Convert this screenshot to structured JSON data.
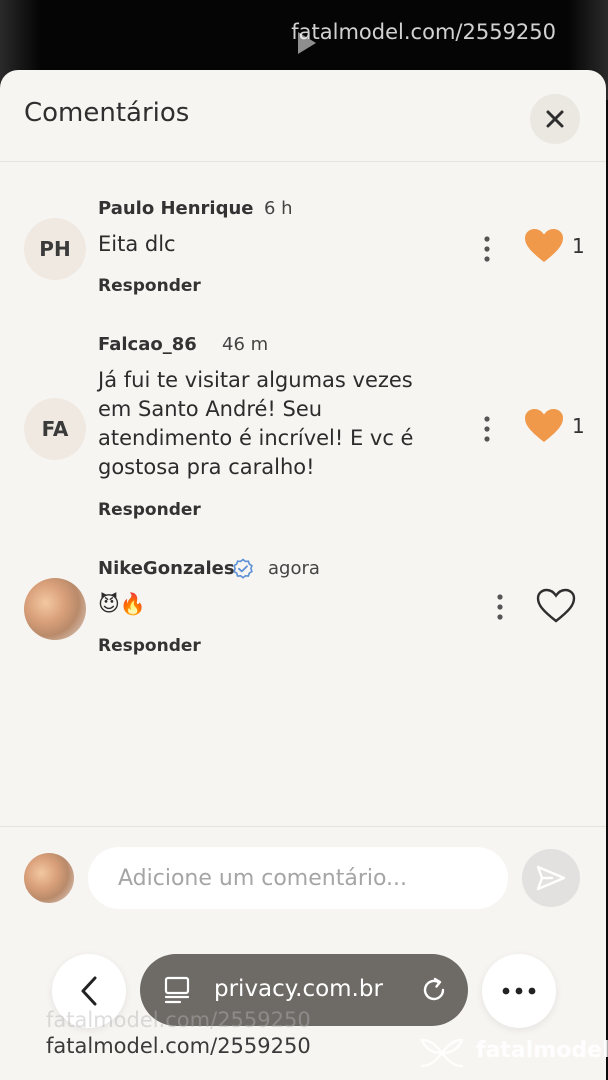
{
  "video": {
    "watermark": "fatalmodel.com/2559250"
  },
  "sheet": {
    "title": "Comentários"
  },
  "comments": [
    {
      "initials": "PH",
      "name": "Paulo Henrique",
      "time": "6 h",
      "text": "Eita dlc",
      "reply_label": "Responder",
      "likes": "1",
      "liked": true,
      "verified": false
    },
    {
      "initials": "FA",
      "name": "Falcao_86",
      "time": "46 m",
      "text": "Já fui te visitar algumas vezes em Santo André! Seu atendimento é incrível! E vc é gostosa pra caralho!",
      "reply_label": "Responder",
      "likes": "1",
      "liked": true,
      "verified": false
    },
    {
      "initials": "",
      "name": "NikeGonzales",
      "time": "agora",
      "text": "😈🔥",
      "reply_label": "Responder",
      "likes": "",
      "liked": false,
      "verified": true
    }
  ],
  "composer": {
    "placeholder": "Adicione um comentário..."
  },
  "browser": {
    "url": "privacy.com.br"
  },
  "watermarks": {
    "ghost": "fatalmodel.com/2559250",
    "bottom": "fatalmodel.com/2559250",
    "brand": "fatalmodel"
  },
  "colors": {
    "heart_liked": "#f0994a",
    "sheet_bg": "#f7f5f2",
    "verified": "#5b8fd6"
  },
  "icons": {
    "close": "close-icon",
    "more": "more-vertical-icon",
    "heart": "heart-icon",
    "send": "send-icon",
    "back": "chevron-left-icon",
    "reload": "reload-icon",
    "menu": "more-horizontal-icon"
  }
}
